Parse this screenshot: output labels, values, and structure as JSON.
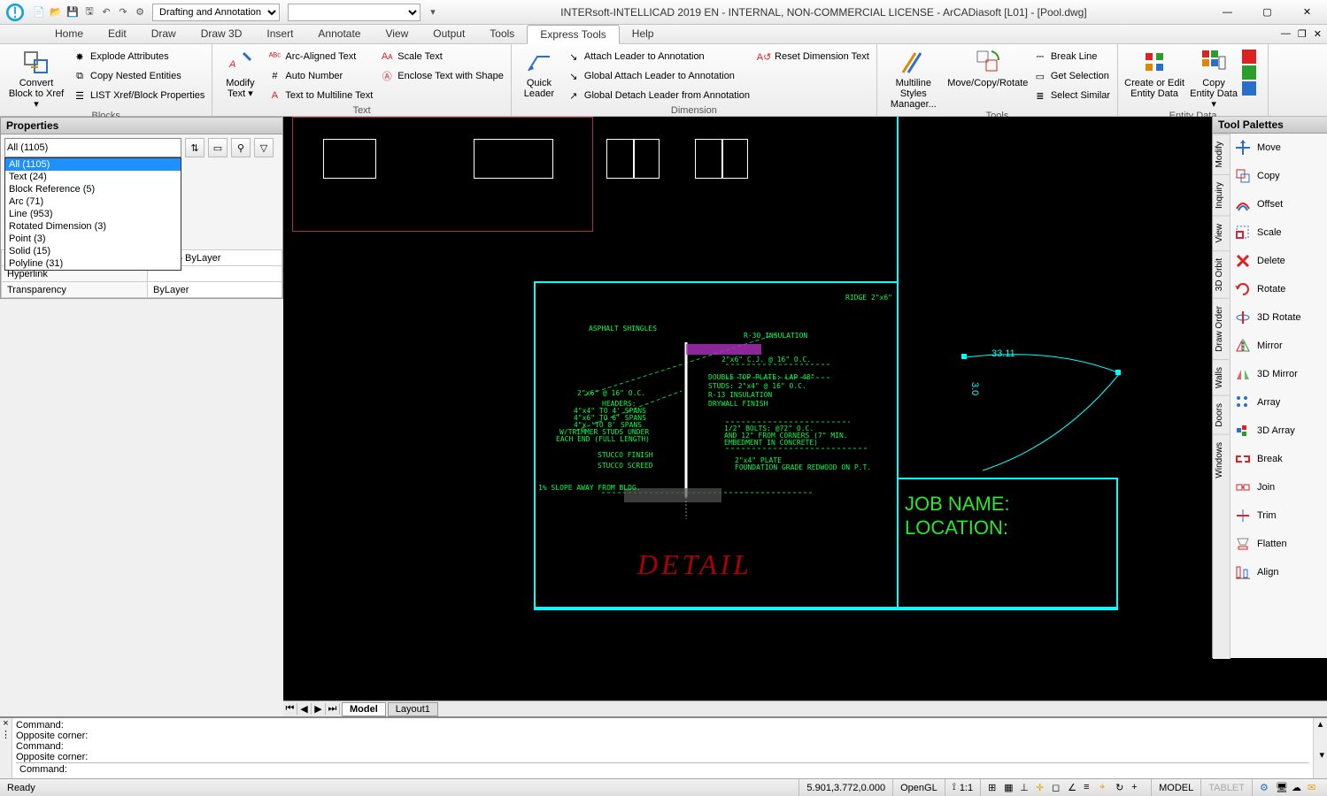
{
  "title": "INTERsoft-INTELLICAD 2019 EN - INTERNAL, NON-COMMERCIAL LICENSE - ArCADiasoft [L01] - [Pool.dwg]",
  "workspace": {
    "active": "Drafting and Annotation",
    "secondary": ""
  },
  "tabs": [
    "Home",
    "Edit",
    "Draw",
    "Draw 3D",
    "Insert",
    "Annotate",
    "View",
    "Output",
    "Tools",
    "Express Tools",
    "Help"
  ],
  "active_tab": "Express Tools",
  "ribbon": {
    "blocks": {
      "title": "Blocks",
      "big": {
        "line1": "Convert",
        "line2": "Block to Xref"
      },
      "items": [
        "Explode Attributes",
        "Copy Nested Entities",
        "LIST Xref/Block Properties"
      ]
    },
    "text": {
      "title": "Text",
      "big": {
        "line1": "Modify",
        "line2": "Text"
      },
      "col1": [
        "Arc-Aligned Text",
        "Auto Number",
        "Text to Multiline Text"
      ],
      "col2": [
        "Scale Text",
        "Enclose Text with Shape"
      ]
    },
    "dimension": {
      "title": "Dimension",
      "big": {
        "line1": "Quick",
        "line2": "Leader"
      },
      "col1": [
        "Attach Leader to Annotation",
        "Global Attach Leader to Annotation",
        "Global Detach Leader from Annotation"
      ],
      "side": "Reset Dimension Text"
    },
    "tools": {
      "title": "Tools",
      "big1": {
        "line1": "Multiline Styles",
        "line2": "Manager..."
      },
      "big2": "Move/Copy/Rotate",
      "col": [
        "Break Line",
        "Get Selection",
        "Select Similar"
      ]
    },
    "entity": {
      "title": "Entity Data",
      "big1": {
        "line1": "Create or Edit",
        "line2": "Entity Data"
      },
      "big2": {
        "line1": "Copy",
        "line2": "Entity Data"
      }
    }
  },
  "properties": {
    "title": "Properties",
    "selected": "All (1105)",
    "dropdown": [
      "All (1105)",
      "Text (24)",
      "Block Reference (5)",
      "Arc (71)",
      "Line (953)",
      "Rotated Dimension (3)",
      "Point (3)",
      "Solid (15)",
      "Polyline (31)"
    ],
    "rows": [
      {
        "label": "Lineweight",
        "value": "——— ByLayer"
      },
      {
        "label": "Hyperlink",
        "value": ""
      },
      {
        "label": "Transparency",
        "value": "ByLayer"
      }
    ]
  },
  "toolpalettes": {
    "title": "Tool Palettes",
    "side_tabs": [
      "Modify",
      "Inquiry",
      "View",
      "3D Orbit",
      "Draw Order",
      "Walls",
      "Doors",
      "Windows"
    ],
    "items": [
      "Move",
      "Copy",
      "Offset",
      "Scale",
      "Delete",
      "Rotate",
      "3D Rotate",
      "Mirror",
      "3D Mirror",
      "Array",
      "3D Array",
      "Break",
      "Join",
      "Trim",
      "Flatten",
      "Align"
    ]
  },
  "canvas": {
    "detail_text": "DETAIL",
    "job_name": "JOB NAME:",
    "location": "LOCATION:",
    "dim_label": "33.11",
    "dim_vert": "3.0",
    "labels": {
      "asphalt": "ASPHALT SHINGLES",
      "insul": "R-30 INSULATION",
      "ridge": "RIDGE 2\"x6\"",
      "rafter": "2\"x6\" @ 16\" O.C.",
      "cj": "2\"x6\" C.J. @ 16\" O.C.",
      "topplate": "DOUBLE TOP PLATE: LAP 48\"",
      "studs": "STUDS: 2\"x4\" @ 16\" O.C.",
      "r13": "R-13 INSULATION",
      "drywall": "DRYWALL FINISH",
      "headers1": "HEADERS:",
      "headers2": "4\"x4\" TO 4' SPANS",
      "headers3": "4\"x6\" TO 6' SPANS",
      "headers4": "4\"x 'TO 8' SPANS",
      "headers5": "W/TRIMMER STUDS UNDER",
      "headers6": "EACH END (FULL LENGTH)",
      "stucco1": "STUCCO FINISH",
      "stucco2": "STUCCO SCREED",
      "slope": "1% SLOPE AWAY FROM BLDG.",
      "bolts1": "1/2\" BOLTS: @72\" O.C.",
      "bolts2": "AND 12\" FROM CORNERS (7\" MIN.",
      "bolts3": "EMBEDMENT IN CONCRETE)",
      "plate1": "2\"x4\" PLATE",
      "plate2": "FOUNDATION GRADE REDWOOD ON P.T."
    }
  },
  "layout_tabs": {
    "model": "Model",
    "layout1": "Layout1"
  },
  "command": {
    "lines": [
      "Command:",
      "Opposite corner:",
      "Command:",
      "Opposite corner:"
    ],
    "prompt": "Command:"
  },
  "status": {
    "ready": "Ready",
    "coords": "5.901,3.772,0.000",
    "opengl": "OpenGL",
    "scale": "1:1",
    "model": "MODEL",
    "tablet": "TABLET"
  }
}
